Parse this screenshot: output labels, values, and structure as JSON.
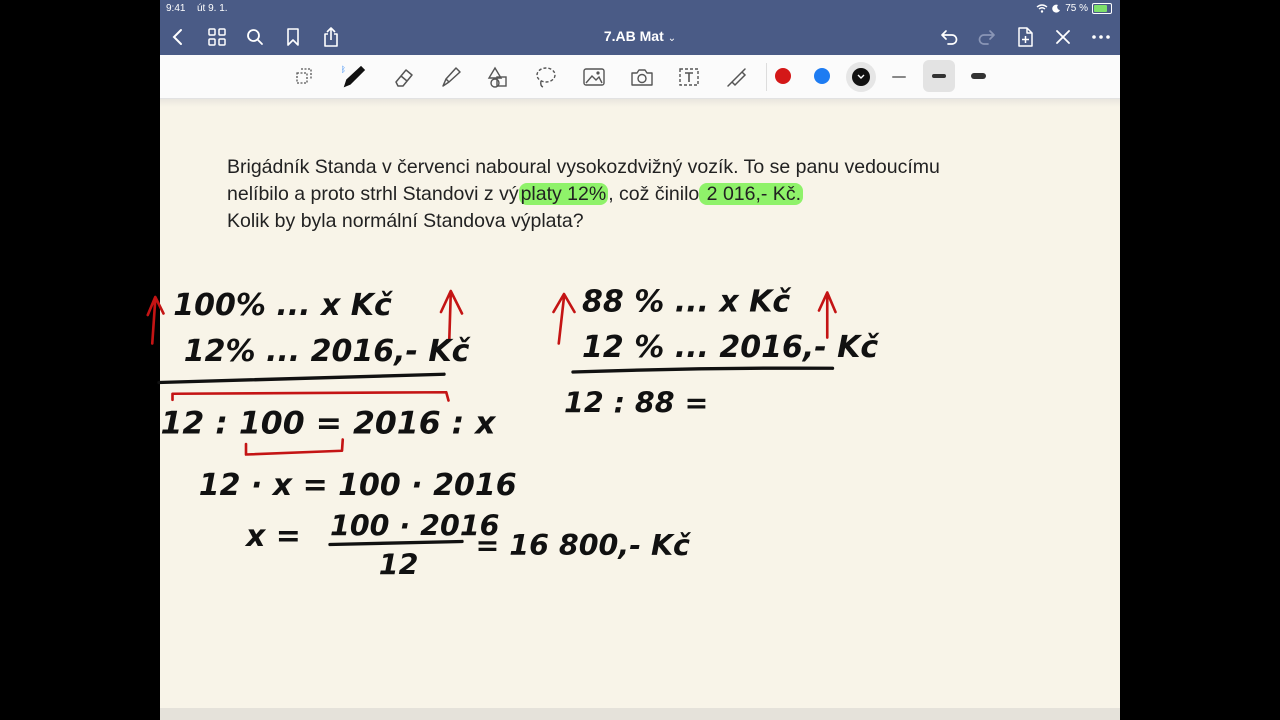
{
  "status_bar": {
    "time": "9:41",
    "date": "út 9. 1.",
    "battery": "75 %"
  },
  "nav": {
    "title": "7.AB Mat"
  },
  "toolbar": {
    "tools": [
      "lasso-select",
      "pen",
      "eraser",
      "highlighter",
      "shapes",
      "lasso",
      "image",
      "camera",
      "text",
      "laser"
    ],
    "colors": [
      "#d41818",
      "#1e7cf2",
      "#111111"
    ],
    "selected_color": "#111111",
    "selected_thickness": "medium"
  },
  "problem": {
    "line1": "Brigádník Standa v červenci naboural vysokozdvižný vozík. To se panu vedoucímu",
    "line2_a": "nelíbilo a proto strhl Standovi z vý",
    "line2_hl1": "platy 12%",
    "line2_b": ", což činilo",
    "line2_hl2": " 2 016,- Kč.",
    "line3": "Kolik by byla normální Standova výplata?"
  },
  "handwriting": {
    "left": {
      "row1": "100% ... x Kč",
      "row2": "12% ... 2016,- Kč",
      "proportion": "12 : 100 = 2016 : x",
      "step1": "12 · x = 100 · 2016",
      "step2_lhs": "x =",
      "step2_num": "100 · 2016",
      "step2_den": "12",
      "result": "= 16 800,- Kč"
    },
    "right": {
      "row1": "88 % ... x Kč",
      "row2": "12 % ... 2016,- Kč",
      "proportion": "12 : 88 ="
    }
  }
}
